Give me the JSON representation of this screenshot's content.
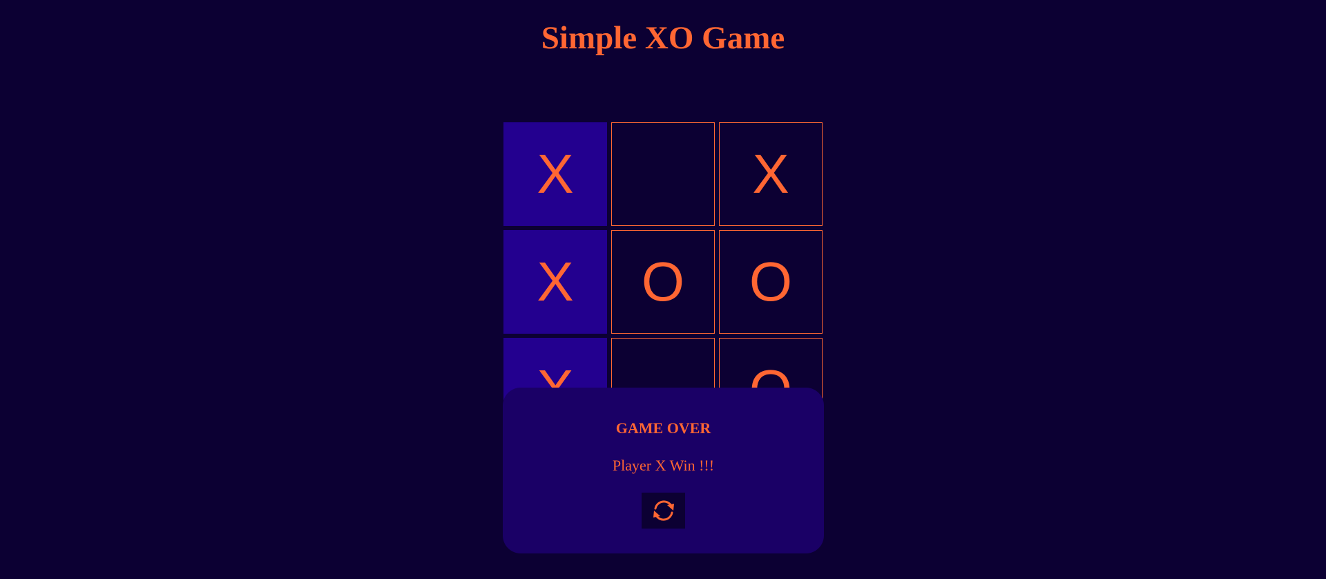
{
  "game": {
    "title": "Simple XO Game",
    "board": [
      [
        "X",
        "",
        "X"
      ],
      [
        "X",
        "O",
        "O"
      ],
      [
        "X",
        "",
        "O"
      ]
    ],
    "winning_cells": [
      [
        0,
        0
      ],
      [
        1,
        0
      ],
      [
        2,
        0
      ]
    ],
    "colors": {
      "background": "#0c0033",
      "accent": "#ff6633",
      "win_highlight": "#23008f",
      "popup_background": "#1a0066"
    }
  },
  "popup": {
    "title": "GAME OVER",
    "message": "Player X Win !!!",
    "restart_icon": "refresh-icon"
  }
}
